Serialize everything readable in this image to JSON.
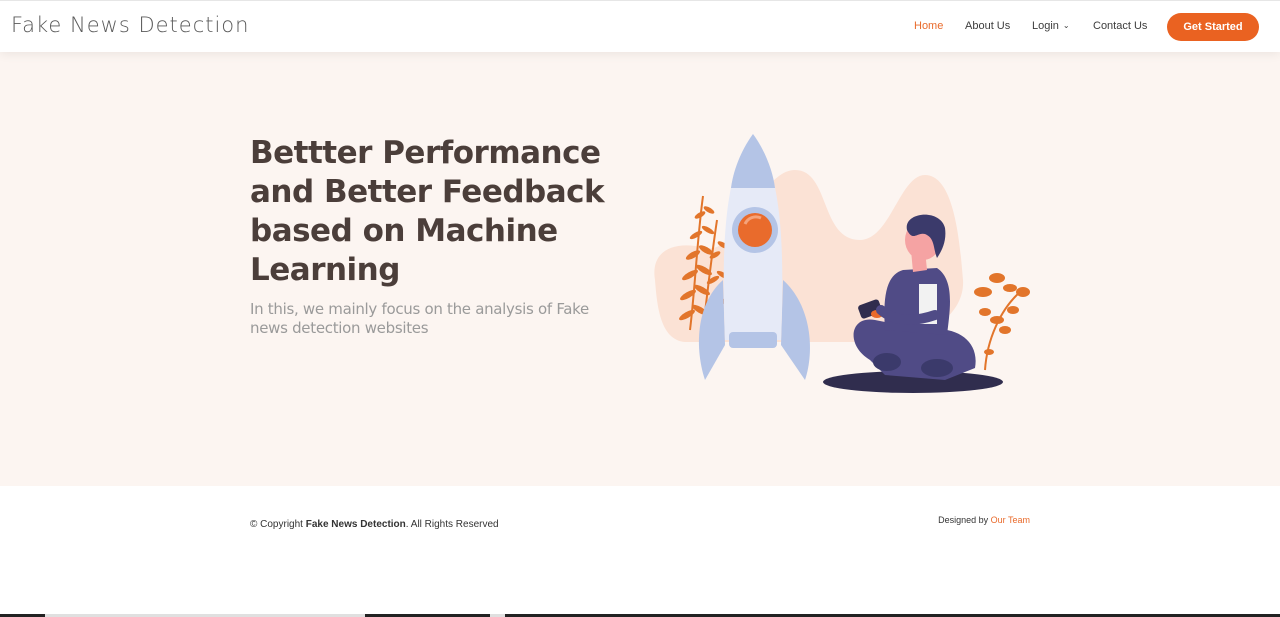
{
  "header": {
    "logo": "Fake News Detection",
    "nav": {
      "home": "Home",
      "about": "About Us",
      "login": "Login",
      "contact": "Contact Us"
    },
    "cta": "Get Started",
    "accent_color": "#ea6221"
  },
  "hero": {
    "title": "Bettter Performance and Better Feedback based on Machine Learning",
    "subtitle": "In this, we mainly focus on the analysis of Fake news detection websites",
    "illustration": "rocket-and-person-illustration"
  },
  "footer": {
    "copyright_prefix": "© Copyright",
    "copyright_brand": "Fake News Detection",
    "copyright_suffix": ". All Rights Reserved",
    "designed_prefix": "Designed by",
    "designed_link": "Our Team"
  }
}
